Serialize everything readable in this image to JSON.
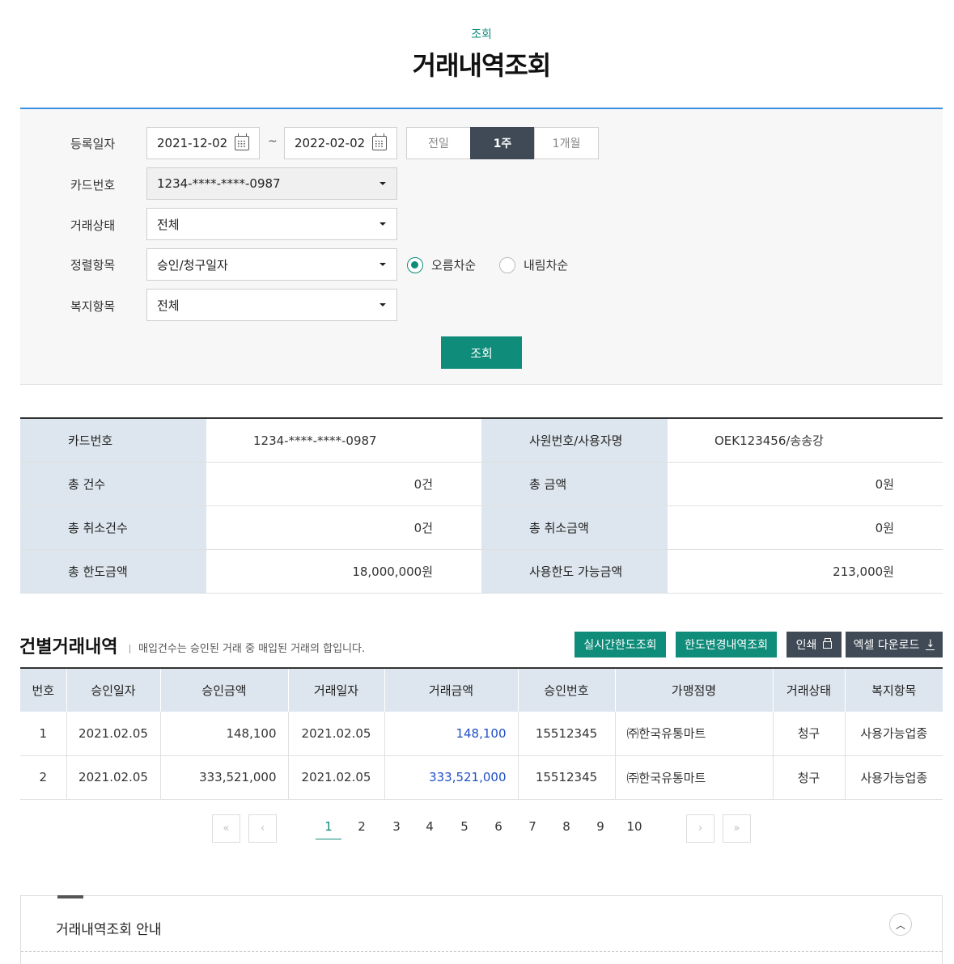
{
  "header": {
    "breadcrumb": "조회",
    "title": "거래내역조회"
  },
  "search": {
    "reg_date_label": "등록일자",
    "start_date": "2021-12-02",
    "tilde": "~",
    "end_date": "2022-02-02",
    "periods": [
      "전일",
      "1주",
      "1개월"
    ],
    "period_selected": "1주",
    "card_label": "카드번호",
    "card_value": "1234-****-****-0987",
    "status_label": "거래상태",
    "status_value": "전체",
    "sort_label": "정렬항목",
    "sort_value": "승인/청구일자",
    "sort_asc": "오름차순",
    "sort_desc": "내림차순",
    "sort_selected": "오름차순",
    "welfare_label": "복지항목",
    "welfare_value": "전체",
    "submit": "조회"
  },
  "summary": {
    "card_label": "카드번호",
    "card_value": "1234-****-****-0987",
    "emp_label": "사원번호/사용자명",
    "emp_value": "OEK123456/송송강",
    "count_label": "총 건수",
    "count_value": "0건",
    "amount_label": "총 금액",
    "amount_value": "0원",
    "cancel_count_label": "총 취소건수",
    "cancel_count_value": "0건",
    "cancel_amount_label": "총 취소금액",
    "cancel_amount_value": "0원",
    "limit_label": "총 한도금액",
    "limit_value": "18,000,000원",
    "available_label": "사용한도 가능금액",
    "available_value": "213,000원"
  },
  "list": {
    "title": "건별거래내역",
    "desc": "매입건수는 승인된 거래 중 매입된 거래의 합입니다.",
    "btn_realtime": "실시간한도조회",
    "btn_limit_history": "한도변경내역조회",
    "btn_print": "인쇄",
    "btn_excel": "엑셀 다운로드",
    "columns": [
      "번호",
      "승인일자",
      "승인금액",
      "거래일자",
      "거래금액",
      "승인번호",
      "가맹점명",
      "거래상태",
      "복지항목"
    ],
    "rows": [
      [
        "1",
        "2021.02.05",
        "148,100",
        "2021.02.05",
        "148,100",
        "15512345",
        "㈜한국유통마트",
        "청구",
        "사용가능업종"
      ],
      [
        "2",
        "2021.02.05",
        "333,521,000",
        "2021.02.05",
        "333,521,000",
        "15512345",
        "㈜한국유통마트",
        "청구",
        "사용가능업종"
      ]
    ]
  },
  "pagination": {
    "first": "«",
    "prev": "‹",
    "next": "›",
    "last": "»",
    "pages": [
      "1",
      "2",
      "3",
      "4",
      "5",
      "6",
      "7",
      "8",
      "9",
      "10"
    ],
    "current": "1"
  },
  "guide": {
    "title": "거래내역조회 안내",
    "toggle_icon": "chevron-up-icon"
  }
}
